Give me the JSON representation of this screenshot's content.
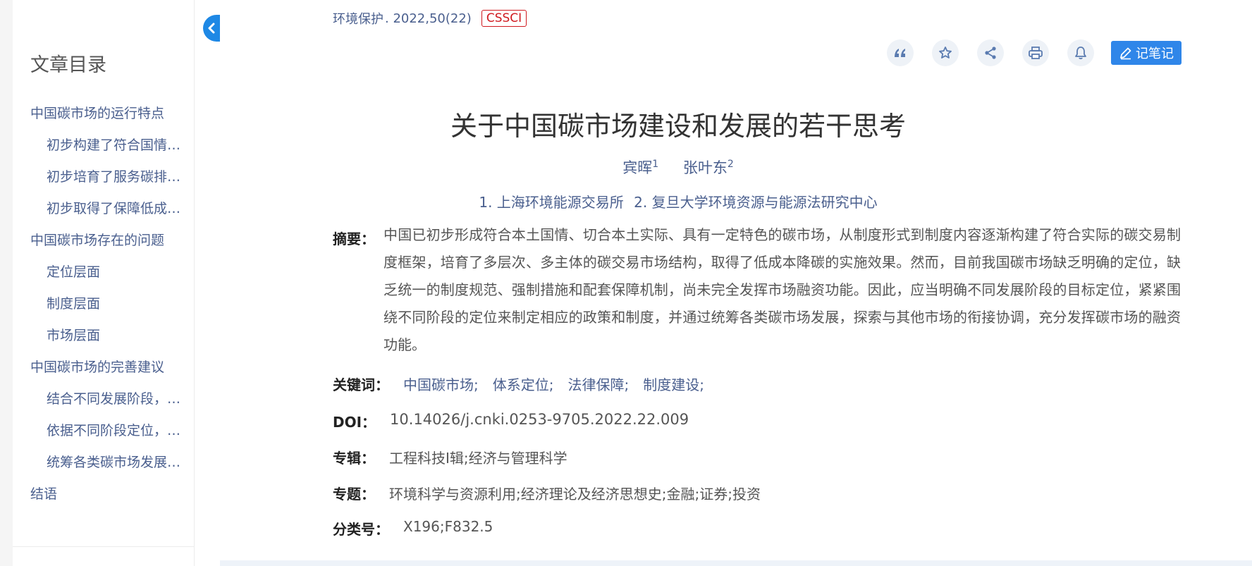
{
  "sidebar": {
    "title": "文章目录",
    "items": [
      {
        "label": "中国碳市场的运行特点",
        "level": 1
      },
      {
        "label": "初步构建了符合国情的...",
        "level": 2
      },
      {
        "label": "初步培育了服务碳排放...",
        "level": 2
      },
      {
        "label": "初步取得了保障低成本...",
        "level": 2
      },
      {
        "label": "中国碳市场存在的问题",
        "level": 1
      },
      {
        "label": "定位层面",
        "level": 2
      },
      {
        "label": "制度层面",
        "level": 2
      },
      {
        "label": "市场层面",
        "level": 2
      },
      {
        "label": "中国碳市场的完善建议",
        "level": 1
      },
      {
        "label": "结合不同发展阶段，确...",
        "level": 2
      },
      {
        "label": "依据不同阶段定位，完...",
        "level": 2
      },
      {
        "label": "统筹各类碳市场发展，...",
        "level": 2
      },
      {
        "label": "结语",
        "level": 1
      }
    ]
  },
  "source": {
    "journal": "环境保护",
    "issue": ". 2022,50(22)",
    "badge": "CSSCI"
  },
  "toolbar": {
    "icons": [
      "quote-icon",
      "star-icon",
      "share-icon",
      "print-icon",
      "bell-icon"
    ],
    "note_label": "记笔记"
  },
  "article": {
    "title": "关于中国碳市场建设和发展的若干思考",
    "authors": [
      {
        "name": "宾晖",
        "sup": "1"
      },
      {
        "name": "张叶东",
        "sup": "2"
      }
    ],
    "affiliations": [
      "1. 上海环境能源交易所",
      "2. 复旦大学环境资源与能源法研究中心"
    ],
    "abstract_label": "摘要：",
    "abstract": "中国已初步形成符合本土国情、切合本土实际、具有一定特色的碳市场，从制度形式到制度内容逐渐构建了符合实际的碳交易制度框架，培育了多层次、多主体的碳交易市场结构，取得了低成本降碳的实施效果。然而，目前我国碳市场缺乏明确的定位，缺乏统一的制度规范、强制措施和配套保障机制，尚未完全发挥市场融资功能。因此，应当明确不同发展阶段的目标定位，紧紧围绕不同阶段的定位来制定相应的政策和制度，并通过统筹各类碳市场发展，探索与其他市场的衔接协调，充分发挥碳市场的融资功能。",
    "keywords_label": "关键词：",
    "keywords": [
      "中国碳市场;",
      "体系定位;",
      "法律保障;",
      "制度建设;"
    ],
    "doi_label": "DOI：",
    "doi": "10.14026/j.cnki.0253-9705.2022.22.009",
    "album_label": "专辑：",
    "album": "工程科技Ⅰ辑;经济与管理科学",
    "topic_label": "专题：",
    "topic": "环境科学与资源利用;经济理论及经济思想史;金融;证券;投资",
    "clc_label": "分类号：",
    "clc": "X196;F832.5"
  },
  "colors": {
    "link": "#4a5f8e",
    "accent": "#2f86e9",
    "badge": "#d0191f"
  }
}
